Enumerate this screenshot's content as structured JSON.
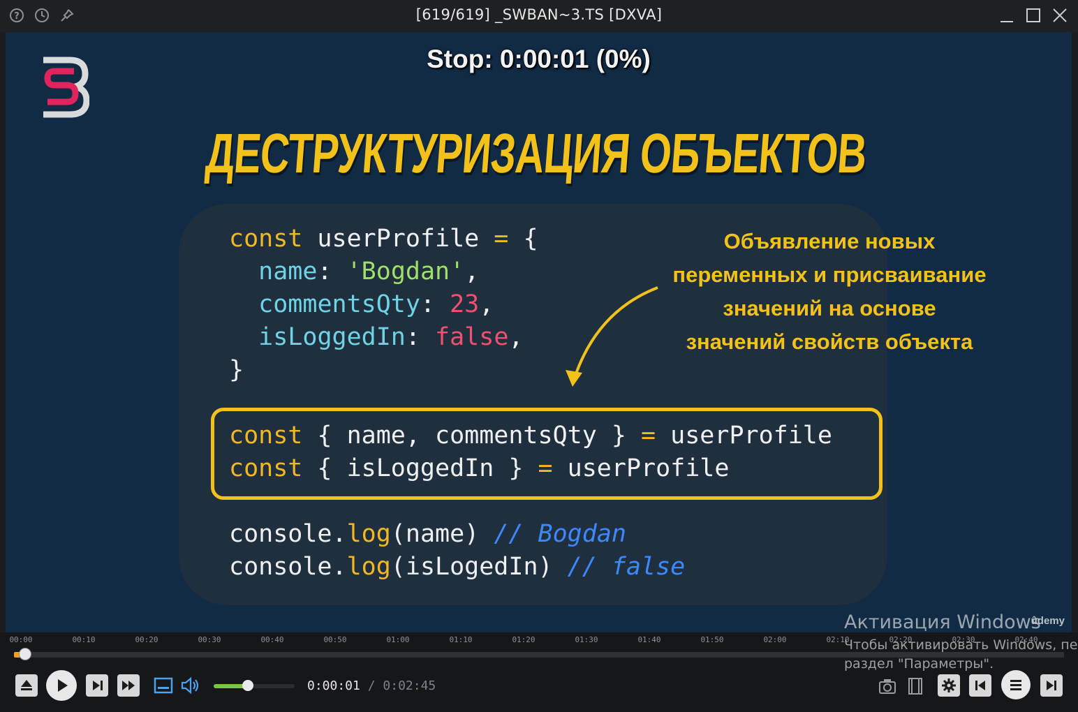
{
  "window": {
    "title": "[619/619] _SWBAN~3.TS [DXVA]",
    "left_icons": [
      "help-icon",
      "history-icon",
      "pin-icon"
    ],
    "right_buttons": [
      "minimize",
      "maximize",
      "close"
    ]
  },
  "osd": {
    "text": "Stop: 0:00:01 (0%)"
  },
  "slide": {
    "title": "ДЕСТРУКТУРИЗАЦИЯ ОБЪЕКТОВ",
    "annotation": [
      "Объявление новых",
      "переменных и присваивание",
      "значений на основе",
      "значений свойств объекта"
    ],
    "code_object": [
      [
        [
          "kw",
          "const"
        ],
        [
          "plain",
          " userProfile "
        ],
        [
          "kw",
          "="
        ],
        [
          "plain",
          " {"
        ]
      ],
      [
        [
          "plain",
          "  "
        ],
        [
          "prop",
          "name"
        ],
        [
          "plain",
          ": "
        ],
        [
          "str",
          "'Bogdan'"
        ],
        [
          "plain",
          ","
        ]
      ],
      [
        [
          "plain",
          "  "
        ],
        [
          "prop",
          "commentsQty"
        ],
        [
          "plain",
          ": "
        ],
        [
          "num",
          "23"
        ],
        [
          "plain",
          ","
        ]
      ],
      [
        [
          "plain",
          "  "
        ],
        [
          "prop",
          "isLoggedIn"
        ],
        [
          "plain",
          ": "
        ],
        [
          "num",
          "false"
        ],
        [
          "plain",
          ","
        ]
      ],
      [
        [
          "plain",
          "}"
        ]
      ]
    ],
    "code_destructure": [
      [
        [
          "kw",
          "const"
        ],
        [
          "plain",
          " { name, commentsQty } "
        ],
        [
          "kw",
          "="
        ],
        [
          "plain",
          " userProfile"
        ]
      ],
      [
        [
          "kw",
          "const"
        ],
        [
          "plain",
          " { isLoggedIn } "
        ],
        [
          "kw",
          "="
        ],
        [
          "plain",
          " userProfile"
        ]
      ]
    ],
    "code_log": [
      [
        [
          "plain",
          "console."
        ],
        [
          "fn",
          "log"
        ],
        [
          "plain",
          "(name) "
        ],
        [
          "cmt",
          "// Bogdan"
        ]
      ],
      [
        [
          "plain",
          "console."
        ],
        [
          "fn",
          "log"
        ],
        [
          "plain",
          "(isLogedIn) "
        ],
        [
          "cmt",
          "// false"
        ]
      ]
    ],
    "watermark": "ûdemy"
  },
  "timeline": {
    "labels": [
      "00:00",
      "00:10",
      "00:20",
      "00:30",
      "00:40",
      "00:50",
      "01:00",
      "01:10",
      "01:20",
      "01:30",
      "01:40",
      "01:50",
      "02:00",
      "02:10",
      "02:20",
      "02:30",
      "02:40"
    ],
    "progress": 0.006
  },
  "controls": {
    "current_time": "0:00:01",
    "separator": "/",
    "duration": "0:02:45",
    "volume": 0.42
  },
  "activation": {
    "line1": "Активация Windows",
    "line2": "Чтобы активировать Windows, пе",
    "line3": "раздел \"Параметры\"."
  },
  "colors": {
    "accent_yellow": "#f3c21a",
    "slide_bg": "#112b45",
    "card_bg": "#1f2f3e",
    "timeline_fill": "#f0a020",
    "volume_fill": "#7cc444"
  }
}
